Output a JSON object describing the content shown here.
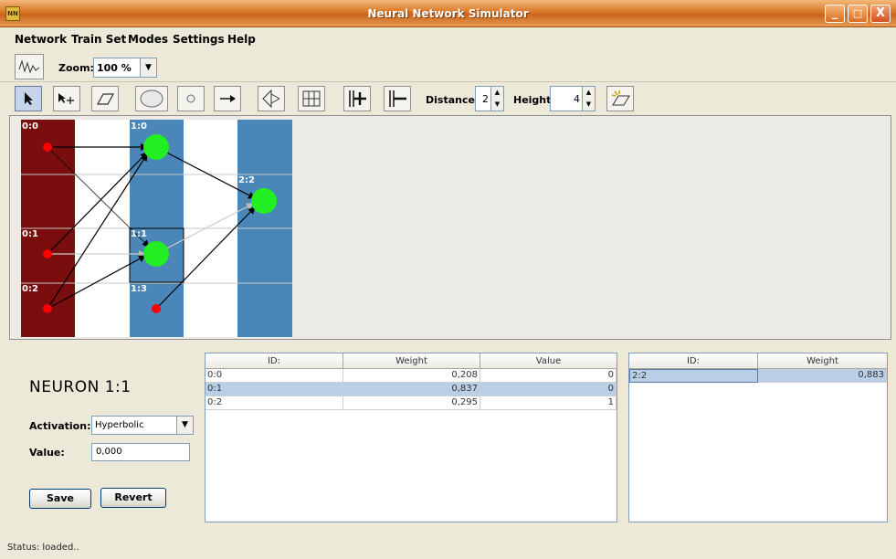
{
  "window": {
    "title": "Neural Network Simulator",
    "icon_text": "NN",
    "controls": [
      "_",
      "□",
      "X"
    ]
  },
  "menu": [
    "Network",
    "Train Set",
    "Modes",
    "Settings",
    "Help"
  ],
  "toolbar": {
    "zoom_label": "Zoom:",
    "zoom_value": "100 %",
    "distance_label": "Distance:",
    "distance_value": "2",
    "height_label": "Height:",
    "height_value": "4",
    "tools": [
      "graph-icon",
      "pointer-icon",
      "move-icon",
      "eraser-icon",
      "large-circle-icon",
      "small-circle-icon",
      "arrow-icon",
      "layout-icon",
      "grid-icon",
      "add-column-icon",
      "remove-column-icon",
      "clear-icon"
    ]
  },
  "network": {
    "colors": {
      "input_layer": "#7a0d0d",
      "hidden_layer": "#4a86b8",
      "neuron_input": "#ff0000",
      "neuron_node": "#22ee22"
    },
    "labels": [
      "0:0",
      "0:1",
      "0:2",
      "1:0",
      "1:1",
      "1:3",
      "2:2"
    ]
  },
  "neuron_panel": {
    "title": "NEURON  1:1",
    "activation_label": "Activation:",
    "activation_value": "Hyperbolic",
    "value_label": "Value:",
    "value_value": "0,000",
    "save_label": "Save",
    "revert_label": "Revert"
  },
  "inputs_table": {
    "headers": [
      "ID:",
      "Weight",
      "Value"
    ],
    "rows": [
      [
        "0:0",
        "0,208",
        "0"
      ],
      [
        "0:1",
        "0,837",
        "0"
      ],
      [
        "0:2",
        "0,295",
        "1"
      ]
    ],
    "selected_row": 1
  },
  "outputs_table": {
    "headers": [
      "ID:",
      "Weight"
    ],
    "rows": [
      [
        "2:2",
        "0,883"
      ]
    ],
    "selected_row": 0
  },
  "status": "Status: loaded.."
}
